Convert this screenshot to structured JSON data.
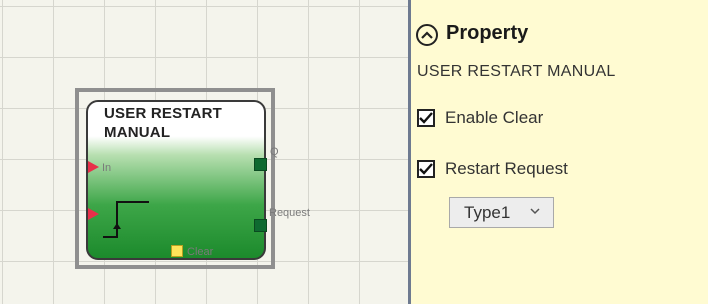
{
  "block": {
    "title_line1": "USER RESTART",
    "title_line2": "MANUAL",
    "inputs": {
      "in_label": "In"
    },
    "outputs": {
      "q_label": "Q",
      "request_label": "Request"
    },
    "bottom_pin_label": "Clear"
  },
  "panel": {
    "title": "Property",
    "subtitle": "USER RESTART MANUAL",
    "options": [
      {
        "label": "Enable Clear",
        "checked": true
      },
      {
        "label": "Restart Request",
        "checked": true
      }
    ],
    "type_select": {
      "value": "Type1"
    }
  }
}
